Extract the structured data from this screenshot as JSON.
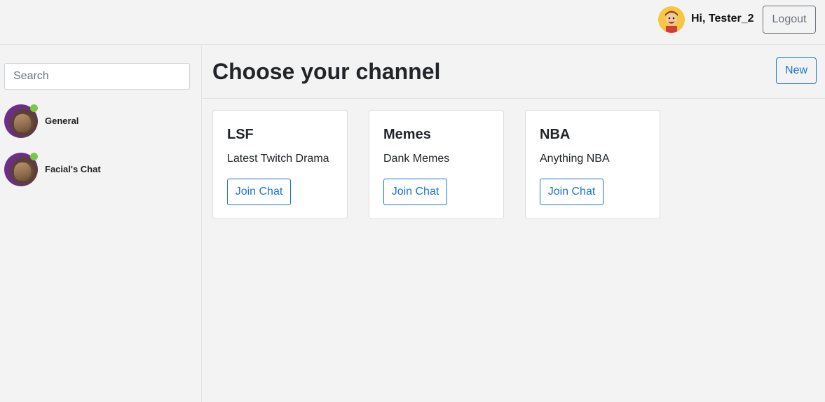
{
  "header": {
    "greeting": "Hi, Tester_2",
    "logout_label": "Logout",
    "avatar_icon": "cartoon-user-avatar"
  },
  "sidebar": {
    "search_placeholder": "Search",
    "search_value": "",
    "chats": [
      {
        "name": "General",
        "online": true,
        "avatar_icon": "anime-character-avatar"
      },
      {
        "name": "Facial's Chat",
        "online": true,
        "avatar_icon": "anime-character-avatar"
      }
    ]
  },
  "main": {
    "title": "Choose your channel",
    "new_label": "New",
    "channels": [
      {
        "title": "LSF",
        "description": "Latest Twitch Drama",
        "button_label": "Join Chat"
      },
      {
        "title": "Memes",
        "description": "Dank Memes",
        "button_label": "Join Chat"
      },
      {
        "title": "NBA",
        "description": "Anything NBA",
        "button_label": "Join Chat"
      }
    ]
  },
  "colors": {
    "background": "#f3f3f3",
    "accent": "#1976d2",
    "online": "#7ac943",
    "secondary": "#6c757d"
  }
}
